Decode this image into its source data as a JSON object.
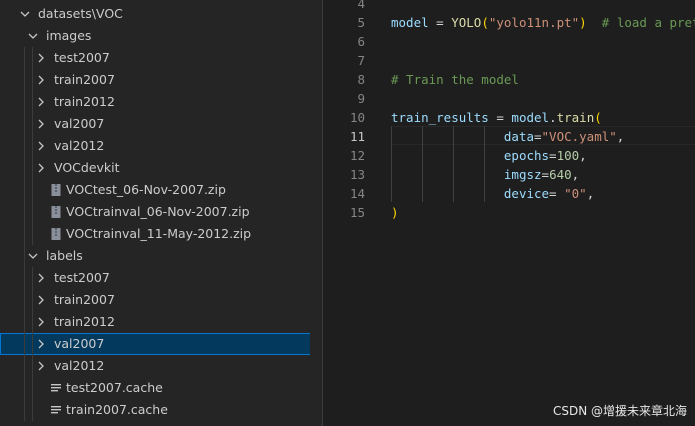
{
  "explorer": {
    "items": [
      {
        "label": "datasets\\VOC",
        "type": "folder",
        "expanded": true,
        "depth": 0
      },
      {
        "label": "images",
        "type": "folder",
        "expanded": true,
        "depth": 1
      },
      {
        "label": "test2007",
        "type": "folder",
        "expanded": false,
        "depth": 2
      },
      {
        "label": "train2007",
        "type": "folder",
        "expanded": false,
        "depth": 2
      },
      {
        "label": "train2012",
        "type": "folder",
        "expanded": false,
        "depth": 2
      },
      {
        "label": "val2007",
        "type": "folder",
        "expanded": false,
        "depth": 2
      },
      {
        "label": "val2012",
        "type": "folder",
        "expanded": false,
        "depth": 2
      },
      {
        "label": "VOCdevkit",
        "type": "folder",
        "expanded": false,
        "depth": 2
      },
      {
        "label": "VOCtest_06-Nov-2007.zip",
        "type": "zip",
        "depth": 2
      },
      {
        "label": "VOCtrainval_06-Nov-2007.zip",
        "type": "zip",
        "depth": 2
      },
      {
        "label": "VOCtrainval_11-May-2012.zip",
        "type": "zip",
        "depth": 2
      },
      {
        "label": "labels",
        "type": "folder",
        "expanded": true,
        "depth": 1
      },
      {
        "label": "test2007",
        "type": "folder",
        "expanded": false,
        "depth": 2
      },
      {
        "label": "train2007",
        "type": "folder",
        "expanded": false,
        "depth": 2
      },
      {
        "label": "train2012",
        "type": "folder",
        "expanded": false,
        "depth": 2
      },
      {
        "label": "val2007",
        "type": "folder",
        "expanded": false,
        "depth": 2,
        "selected": true
      },
      {
        "label": "val2012",
        "type": "folder",
        "expanded": false,
        "depth": 2
      },
      {
        "label": "test2007.cache",
        "type": "cache",
        "depth": 2
      },
      {
        "label": "train2007.cache",
        "type": "cache",
        "depth": 2
      }
    ]
  },
  "editor": {
    "active_line": 11,
    "lines": [
      {
        "num": 4,
        "tokens": []
      },
      {
        "num": 5,
        "tokens": [
          {
            "t": "var",
            "v": "model"
          },
          {
            "t": "plain",
            "v": " = "
          },
          {
            "t": "fn",
            "v": "YOLO"
          },
          {
            "t": "br1",
            "v": "("
          },
          {
            "t": "str",
            "v": "\"yolo11n.pt\""
          },
          {
            "t": "br1",
            "v": ")"
          },
          {
            "t": "plain",
            "v": "  "
          },
          {
            "t": "cmt",
            "v": "# load a pretrained model"
          }
        ]
      },
      {
        "num": 6,
        "tokens": []
      },
      {
        "num": 7,
        "tokens": []
      },
      {
        "num": 8,
        "tokens": [
          {
            "t": "cmt",
            "v": "# Train the model"
          }
        ]
      },
      {
        "num": 9,
        "tokens": []
      },
      {
        "num": 10,
        "tokens": [
          {
            "t": "var",
            "v": "train_results"
          },
          {
            "t": "plain",
            "v": " = "
          },
          {
            "t": "var",
            "v": "model"
          },
          {
            "t": "plain",
            "v": "."
          },
          {
            "t": "fn",
            "v": "train"
          },
          {
            "t": "br1",
            "v": "("
          }
        ]
      },
      {
        "num": 11,
        "tokens": [
          {
            "t": "plain",
            "v": "               "
          },
          {
            "t": "var",
            "v": "data"
          },
          {
            "t": "plain",
            "v": "="
          },
          {
            "t": "str",
            "v": "\"VOC.yaml\""
          },
          {
            "t": "plain",
            "v": ","
          }
        ]
      },
      {
        "num": 12,
        "tokens": [
          {
            "t": "plain",
            "v": "               "
          },
          {
            "t": "var",
            "v": "epochs"
          },
          {
            "t": "plain",
            "v": "="
          },
          {
            "t": "num",
            "v": "100"
          },
          {
            "t": "plain",
            "v": ","
          }
        ]
      },
      {
        "num": 13,
        "tokens": [
          {
            "t": "plain",
            "v": "               "
          },
          {
            "t": "var",
            "v": "imgsz"
          },
          {
            "t": "plain",
            "v": "="
          },
          {
            "t": "num",
            "v": "640"
          },
          {
            "t": "plain",
            "v": ","
          }
        ]
      },
      {
        "num": 14,
        "tokens": [
          {
            "t": "plain",
            "v": "               "
          },
          {
            "t": "var",
            "v": "device"
          },
          {
            "t": "plain",
            "v": "= "
          },
          {
            "t": "str",
            "v": "\"0\""
          },
          {
            "t": "plain",
            "v": ","
          }
        ]
      },
      {
        "num": 15,
        "tokens": [
          {
            "t": "br1",
            "v": ")"
          }
        ]
      }
    ]
  },
  "watermark": "CSDN @增援未来章北海",
  "colors": {
    "sidebar_bg": "#252526",
    "editor_bg": "#1e1e1e",
    "selection_bg": "#04395e",
    "selection_border": "#0078d4",
    "string": "#ce9178",
    "number": "#b5cea8",
    "comment": "#6a9955",
    "variable": "#9cdcfe",
    "function": "#dcdcaa"
  }
}
